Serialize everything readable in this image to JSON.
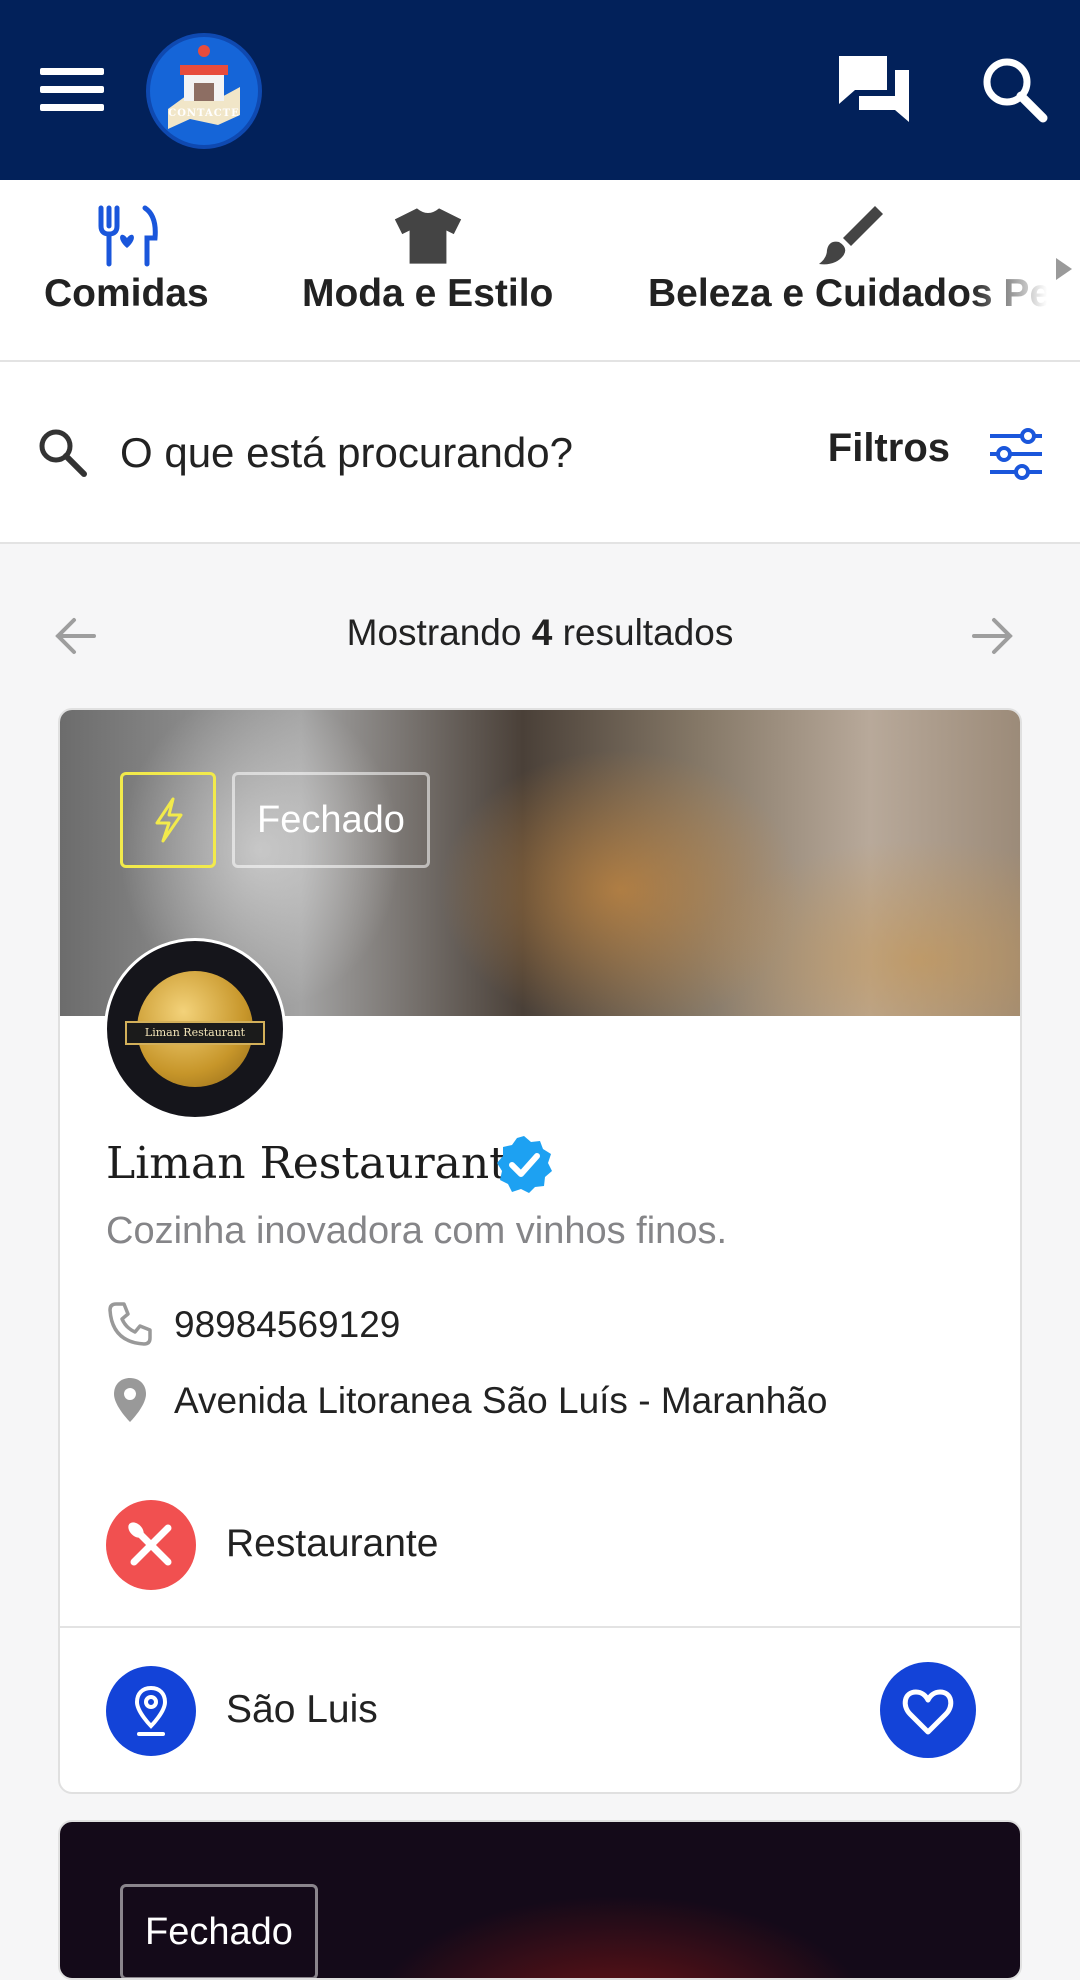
{
  "app": {
    "logo_text": "CONTACTE"
  },
  "colors": {
    "header_bg": "#02215a",
    "accent_blue": "#1343d8",
    "category_red": "#f15050",
    "verified": "#1da1f2",
    "bolt_yellow": "#f2ea4b"
  },
  "categories": [
    {
      "label": "Comidas",
      "icon": "food-icon"
    },
    {
      "label": "Moda e Estilo",
      "icon": "tshirt-icon"
    },
    {
      "label": "Beleza e Cuidados Pe",
      "icon": "brush-icon"
    }
  ],
  "search": {
    "placeholder": "O que está procurando?",
    "filters_label": "Filtros"
  },
  "results": {
    "prefix": "Mostrando",
    "count": "4",
    "suffix": "resultados"
  },
  "listing": {
    "status": "Fechado",
    "avatar_label": "Liman Restaurant",
    "name": "Liman Restaurant",
    "description": "Cozinha inovadora com vinhos finos.",
    "phone": "98984569129",
    "address": "Avenida Litoranea São Luís - Maranhão",
    "category": "Restaurante",
    "city": "São Luis"
  },
  "listing2": {
    "status": "Fechado"
  }
}
